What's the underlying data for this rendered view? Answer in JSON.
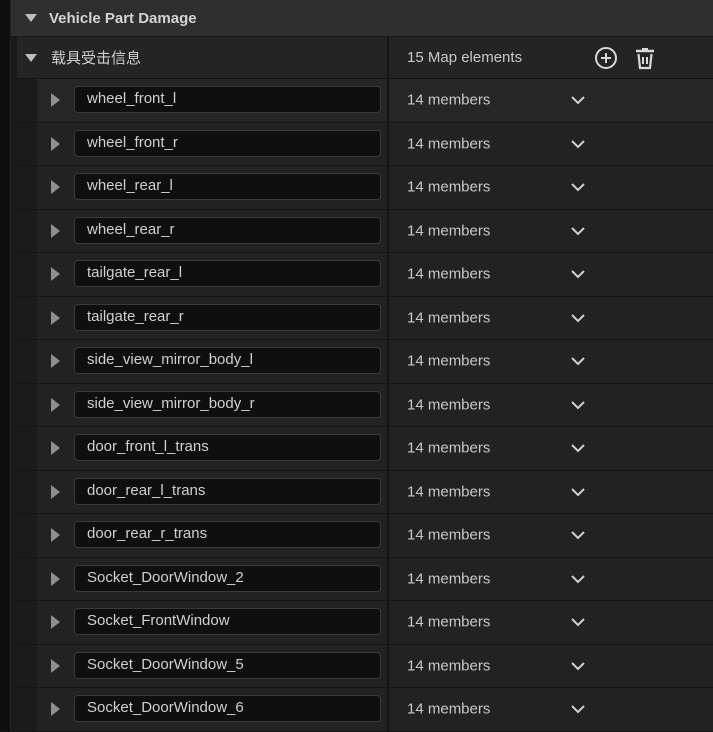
{
  "category": {
    "title": "Vehicle Part Damage"
  },
  "map": {
    "name": "载具受击信息",
    "count_label": "15 Map elements",
    "add_icon": "plus-circle-icon",
    "delete_icon": "trash-icon"
  },
  "rows": [
    {
      "key": "wheel_front_l",
      "value": "14 members"
    },
    {
      "key": "wheel_front_r",
      "value": "14 members"
    },
    {
      "key": "wheel_rear_l",
      "value": "14 members"
    },
    {
      "key": "wheel_rear_r",
      "value": "14 members"
    },
    {
      "key": "tailgate_rear_l",
      "value": "14 members"
    },
    {
      "key": "tailgate_rear_r",
      "value": "14 members"
    },
    {
      "key": "side_view_mirror_body_l",
      "value": "14 members"
    },
    {
      "key": "side_view_mirror_body_r",
      "value": "14 members"
    },
    {
      "key": "door_front_l_trans",
      "value": "14 members"
    },
    {
      "key": "door_rear_l_trans",
      "value": "14 members"
    },
    {
      "key": "door_rear_r_trans",
      "value": "14 members"
    },
    {
      "key": "Socket_DoorWindow_2",
      "value": "14 members"
    },
    {
      "key": "Socket_FrontWindow",
      "value": "14 members"
    },
    {
      "key": "Socket_DoorWindow_5",
      "value": "14 members"
    },
    {
      "key": "Socket_DoorWindow_6",
      "value": "14 members"
    }
  ]
}
